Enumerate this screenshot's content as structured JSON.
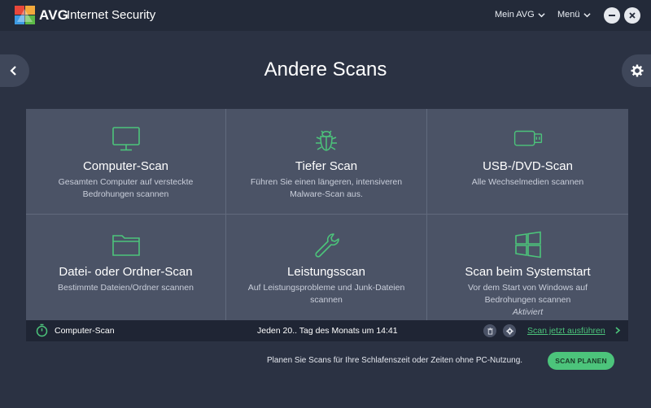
{
  "header": {
    "brand": "AVG",
    "product": "Internet Security",
    "menu_account": "Mein AVG",
    "menu_main": "Menü",
    "logo_icon": "avg-logo",
    "minimize_icon": "minimize-icon",
    "close_icon": "close-icon"
  },
  "nav": {
    "back_icon": "chevron-left-icon",
    "settings_icon": "gear-icon"
  },
  "page": {
    "title": "Andere Scans"
  },
  "tiles": [
    {
      "title": "Computer-Scan",
      "desc1": "Gesamten Computer auf versteckte",
      "desc2": "Bedrohungen scannen",
      "icon": "monitor-icon"
    },
    {
      "title": "Tiefer Scan",
      "desc1": "Führen Sie einen längeren, intensiveren",
      "desc2": "Malware-Scan aus.",
      "icon": "bug-icon"
    },
    {
      "title": "USB-/DVD-Scan",
      "desc1": "Alle Wechselmedien scannen",
      "desc2": "",
      "icon": "usb-icon"
    },
    {
      "title": "Datei- oder Ordner-Scan",
      "desc1": "Bestimmte Dateien/Ordner scannen",
      "desc2": "",
      "icon": "folder-icon"
    },
    {
      "title": "Leistungsscan",
      "desc1": "Auf Leistungsprobleme und Junk-Dateien",
      "desc2": "scannen",
      "icon": "wrench-icon"
    },
    {
      "title": "Scan beim Systemstart",
      "desc1": "Vor dem Start von Windows auf",
      "desc2": "Bedrohungen scannen",
      "status": "Aktiviert",
      "icon": "windows-icon"
    }
  ],
  "schedule": {
    "name": "Computer-Scan",
    "time": "Jeden 20.. Tag des Monats um 14:41",
    "run_label": "Scan jetzt ausführen",
    "icon": "stopwatch-icon",
    "delete_icon": "trash-icon",
    "settings_icon": "gear-icon"
  },
  "footer": {
    "text": "Planen Sie Scans für Ihre Schlafenszeit oder Zeiten ohne PC-Nutzung.",
    "button_label": "SCAN PLANEN"
  },
  "colors": {
    "background": "#2b3243",
    "titlebar": "#232a39",
    "tile": "#4b5366",
    "accent": "#4cc47b",
    "schedule_bar": "#1f2534"
  }
}
